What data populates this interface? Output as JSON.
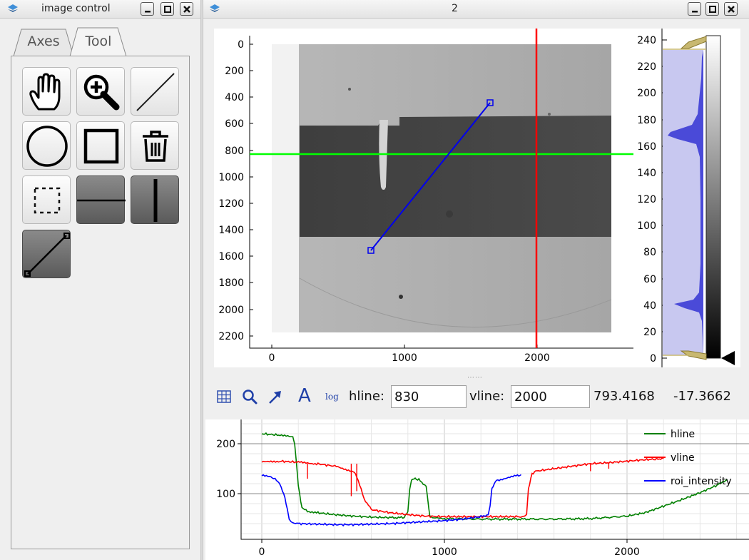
{
  "left_window": {
    "title": "image control",
    "tabs": [
      {
        "label": "Axes",
        "active": false
      },
      {
        "label": "Tool",
        "active": true
      }
    ],
    "tools": [
      {
        "name": "pan-tool",
        "icon": "hand-icon",
        "active": false
      },
      {
        "name": "zoom-tool",
        "icon": "zoom-in-icon",
        "active": false
      },
      {
        "name": "line-tool",
        "icon": "diagonal-line-icon",
        "active": false
      },
      {
        "name": "circle-tool",
        "icon": "circle-icon",
        "active": false
      },
      {
        "name": "rectangle-tool",
        "icon": "square-icon",
        "active": false
      },
      {
        "name": "delete-tool",
        "icon": "trash-icon",
        "active": false
      },
      {
        "name": "rect-select-tool",
        "icon": "dashed-rect-icon",
        "active": false
      },
      {
        "name": "hline-tool",
        "icon": "horizontal-line-icon",
        "active": true
      },
      {
        "name": "vline-tool",
        "icon": "vertical-line-icon",
        "active": true
      },
      {
        "name": "line-roi-tool",
        "icon": "line-handles-icon",
        "active": true
      }
    ]
  },
  "right_window": {
    "title": "2"
  },
  "image_plot": {
    "y_ticks": [
      "0",
      "200",
      "400",
      "600",
      "800",
      "1000",
      "1200",
      "1400",
      "1600",
      "1800",
      "2000",
      "2200"
    ],
    "x_ticks": [
      "0",
      "1000",
      "2000"
    ],
    "hline_y": 830,
    "vline_x": 2000,
    "roi_line": {
      "start": [
        740,
        1550
      ],
      "end": [
        1650,
        440
      ]
    },
    "colors": {
      "hline": "#00ff00",
      "vline": "#ff0000",
      "roi": "#0000ee"
    }
  },
  "histogram": {
    "ticks": [
      "0",
      "20",
      "40",
      "60",
      "80",
      "100",
      "120",
      "140",
      "160",
      "180",
      "200",
      "220",
      "240"
    ],
    "level_min": 0,
    "level_max": 233
  },
  "toolbar": {
    "icons": [
      "grid-icon",
      "magnifier-icon",
      "arrow-icon",
      "text-icon",
      "log-icon"
    ],
    "log_label": "log",
    "text_label": "A",
    "hline_label": "hline:",
    "hline_value": "830",
    "vline_label": "vline:",
    "vline_value": "2000",
    "readout_x": "793.4168",
    "readout_y": "-17.3662"
  },
  "chart_data": {
    "type": "line",
    "x_ticks": [
      "0",
      "1000",
      "2000"
    ],
    "y_ticks": [
      "100",
      "200"
    ],
    "xlim": [
      -120,
      2650
    ],
    "ylim": [
      15,
      245
    ],
    "legend_position": "top-right",
    "grid": true,
    "series": [
      {
        "name": "hline",
        "color": "#008000",
        "x": [
          0,
          100,
          150,
          170,
          180,
          190,
          200,
          220,
          250,
          300,
          400,
          500,
          600,
          700,
          780,
          800,
          810,
          820,
          840,
          860,
          900,
          915,
          920,
          935,
          950,
          1000,
          1200,
          1400,
          1600,
          1800,
          2000,
          2100,
          2200,
          2300,
          2400,
          2500,
          2550
        ],
        "y": [
          220,
          217,
          214,
          214,
          200,
          160,
          115,
          72,
          65,
          62,
          58,
          55,
          53,
          52,
          52,
          65,
          110,
          128,
          130,
          128,
          115,
          70,
          55,
          52,
          51,
          50,
          49,
          49,
          49,
          50,
          55,
          62,
          75,
          88,
          102,
          118,
          127
        ]
      },
      {
        "name": "vline",
        "color": "#ff0000",
        "x": [
          0,
          50,
          100,
          200,
          250,
          300,
          400,
          450,
          500,
          520,
          560,
          600,
          700,
          800,
          900,
          1000,
          1100,
          1200,
          1300,
          1400,
          1440,
          1450,
          1460,
          1480,
          1500,
          1600,
          1700,
          1800,
          1900,
          2000,
          2100,
          2200
        ],
        "y": [
          163,
          165,
          165,
          163,
          162,
          160,
          155,
          150,
          145,
          135,
          90,
          68,
          62,
          58,
          55,
          54,
          54,
          54,
          54,
          54,
          54,
          60,
          110,
          140,
          145,
          150,
          155,
          160,
          162,
          165,
          168,
          170
        ]
      },
      {
        "name": "roi_intensity",
        "color": "#0000ff",
        "x": [
          0,
          50,
          80,
          100,
          120,
          140,
          150,
          160,
          200,
          300,
          400,
          500,
          600,
          700,
          800,
          900,
          1000,
          1100,
          1200,
          1240,
          1250,
          1260,
          1280,
          1300,
          1350,
          1400,
          1420
        ],
        "y": [
          136,
          133,
          128,
          118,
          100,
          70,
          50,
          43,
          40,
          39,
          38,
          38,
          39,
          40,
          42,
          44,
          46,
          49,
          54,
          58,
          75,
          110,
          125,
          128,
          132,
          136,
          138
        ]
      }
    ]
  }
}
